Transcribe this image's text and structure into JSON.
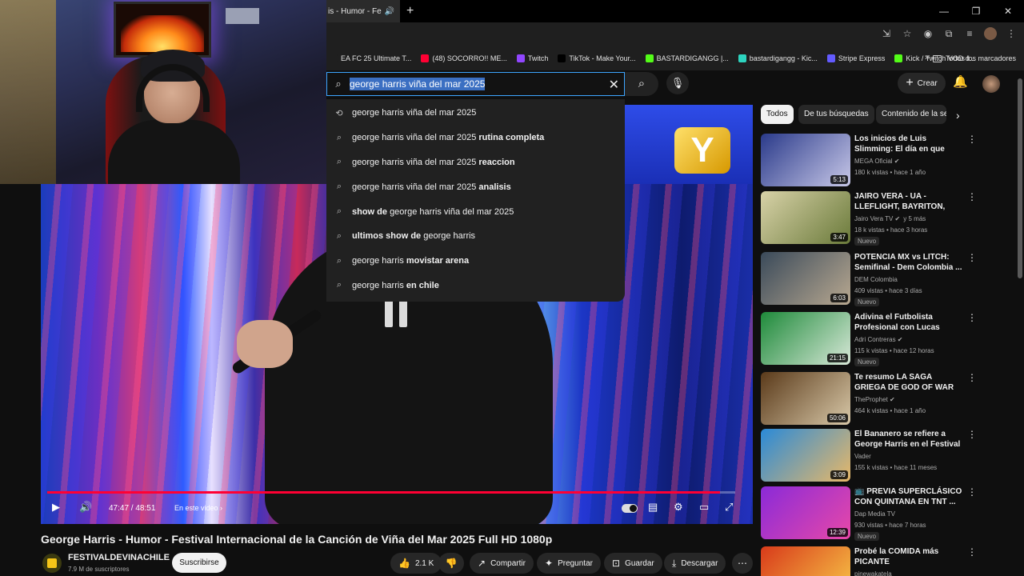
{
  "browser": {
    "tab_title": "is - Humor - Fe",
    "bookmarks": [
      {
        "label": "EA FC 25 Ultimate T...",
        "color": "#1f1f1f"
      },
      {
        "label": "(48) SOCORRO!! ME...",
        "color": "#ff0033"
      },
      {
        "label": "Twitch",
        "color": "#9146ff"
      },
      {
        "label": "TikTok - Make Your...",
        "color": "#000000"
      },
      {
        "label": "BASTARDIGANGG |...",
        "color": "#53fc18"
      },
      {
        "label": "bastardigangg - Kic...",
        "color": "#2dd4bf"
      },
      {
        "label": "Stripe Express",
        "color": "#635bff"
      },
      {
        "label": "Kick / Twitch VOD d...",
        "color": "#53fc18"
      }
    ],
    "all_bookmarks_label": "Todos los marcadores"
  },
  "search": {
    "query": "george harris viña del mar 2025",
    "suggestions": [
      {
        "base": "george harris viña del mar 2025",
        "bold": "",
        "icon": "history-icon"
      },
      {
        "base": "george harris viña del mar 2025 ",
        "bold": "rutina completa",
        "icon": "search-icon"
      },
      {
        "base": "george harris viña del mar 2025 ",
        "bold": "reaccion",
        "icon": "search-icon"
      },
      {
        "base": "george harris viña del mar 2025 ",
        "bold": "analisis",
        "icon": "search-icon"
      },
      {
        "pre": "show de ",
        "base": "george harris viña del mar 2025",
        "icon": "search-icon"
      },
      {
        "pre": "ultimos show de ",
        "base": "george harris",
        "icon": "search-icon"
      },
      {
        "base": "george harris ",
        "bold": "movistar arena",
        "icon": "search-icon"
      },
      {
        "base": "george harris ",
        "bold": "en chile",
        "icon": "search-icon"
      }
    ]
  },
  "header": {
    "create_label": "Crear"
  },
  "player": {
    "time": "47:47 / 48:51",
    "chapter_label": "En este video",
    "progress": 0.978
  },
  "video": {
    "title": "George Harris - Humor - Festival Internacional de la Canción de Viña del Mar 2025 Full HD 1080p",
    "channel": "FESTIVALDEVINACHILE",
    "subscribers": "7.9 M de suscriptores",
    "subscribe_label": "Suscribirse",
    "likes": "2.1 K",
    "share_label": "Compartir",
    "ask_label": "Preguntar",
    "save_label": "Guardar",
    "download_label": "Descargar"
  },
  "chips": [
    "Todos",
    "De tus búsquedas",
    "Contenido de la ser"
  ],
  "recommendations": [
    {
      "title": "Los inicios de Luis Slimming: El día en que apareció en Coliseo...",
      "channel": "MEGA Oficial",
      "verified": true,
      "stats": "180 k vistas • hace 1 año",
      "duration": "5:13",
      "badge": "",
      "thumb": [
        "#2a3a8a",
        "#c8c8e8"
      ]
    },
    {
      "title": "JAIRO VERA - UA - LLEFLIGHT, BAYRITON, GINO MELLA, KIN...",
      "channel": "Jairo Vera TV",
      "verified": true,
      "extra": "y 5 más",
      "stats": "18 k vistas • hace 3 horas",
      "duration": "3:47",
      "badge": "Nuevo",
      "thumb": [
        "#d8d2a8",
        "#6a7a3a"
      ]
    },
    {
      "title": "POTENCIA MX vs LITCH: Semifinal - Dem Colombia ...",
      "channel": "DEM Colombia",
      "verified": false,
      "stats": "409 vistas • hace 3 días",
      "duration": "6:03",
      "badge": "Nuevo",
      "thumb": [
        "#3a4a5a",
        "#b8a890"
      ]
    },
    {
      "title": "Adivina el Futbolista Profesional con Lucas Perez y ...",
      "channel": "Adri Contreras",
      "verified": true,
      "stats": "115 k vistas • hace 12 horas",
      "duration": "21:15",
      "badge": "Nuevo",
      "thumb": [
        "#1e8a3a",
        "#d8e8d8"
      ]
    },
    {
      "title": "Te resumo LA SAGA GRIEGA DE GOD OF WAR",
      "channel": "TheProphet",
      "verified": true,
      "stats": "464 k vistas • hace 1 año",
      "duration": "50:06",
      "badge": "",
      "thumb": [
        "#5a3a1a",
        "#d8c8a8"
      ]
    },
    {
      "title": "El Bananero se refiere a George Harris en el Festival de Viña ...",
      "channel": "Vader",
      "verified": false,
      "stats": "155 k vistas • hace 11 meses",
      "duration": "3:09",
      "badge": "",
      "thumb": [
        "#2a8ad8",
        "#e8b868"
      ]
    },
    {
      "title": "📺 PREVIA SUPERCLÁSICO CON QUINTANA EN TNT ...",
      "channel": "Dap Media TV",
      "verified": false,
      "stats": "930 vistas • hace 7 horas",
      "duration": "12:39",
      "badge": "Nuevo",
      "thumb": [
        "#8a2ad8",
        "#e848a8"
      ]
    },
    {
      "title": "Probé la COMIDA más PICANTE",
      "channel": "pinewakatela",
      "verified": false,
      "stats": "",
      "duration": "",
      "badge": "",
      "thumb": [
        "#d83a1a",
        "#f8c848"
      ]
    }
  ],
  "colors": {
    "accent": "#ff0033",
    "link": "#3ea6ff"
  }
}
